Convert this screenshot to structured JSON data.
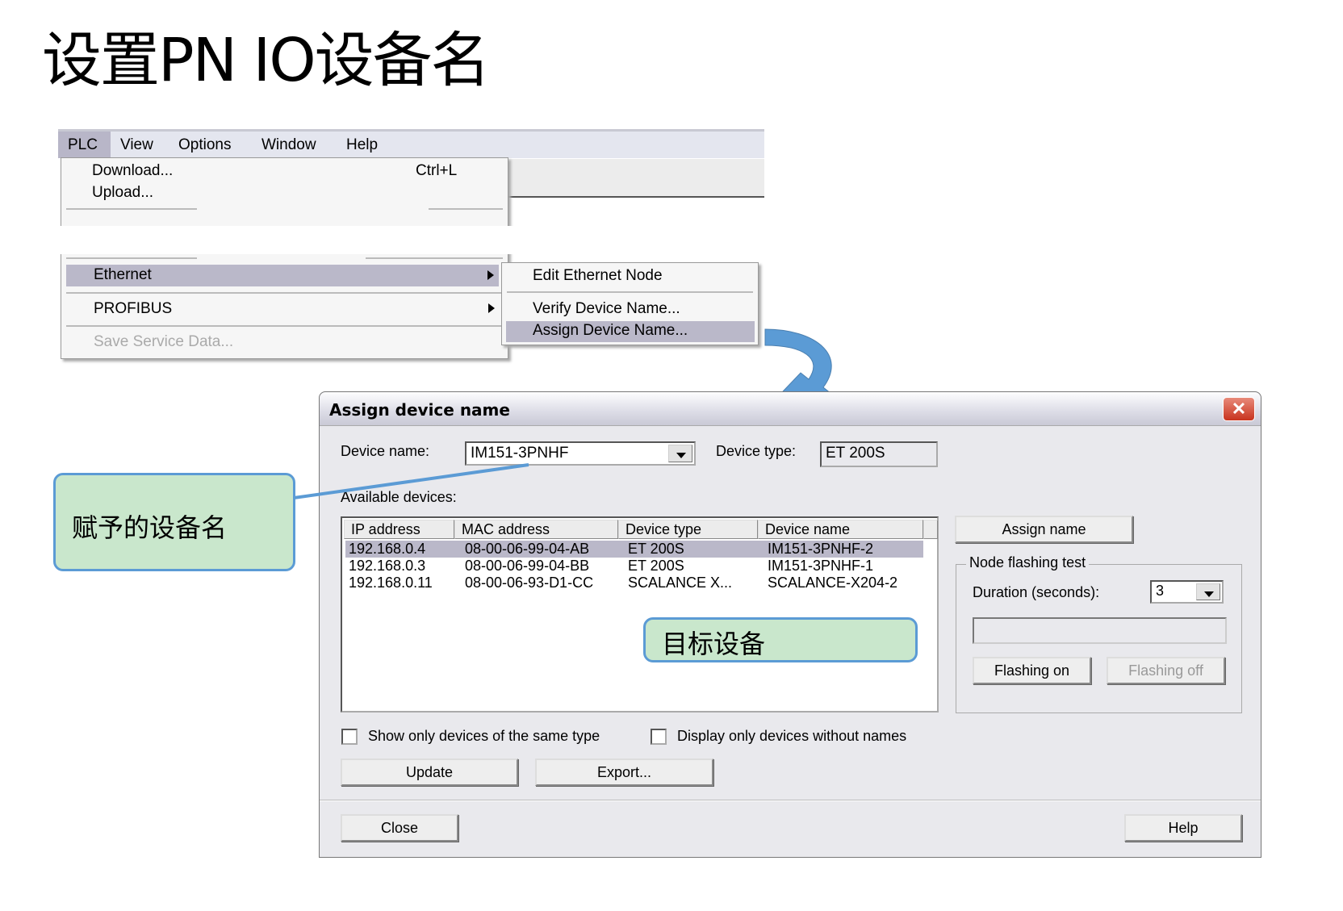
{
  "title": "设置PN IO设备名",
  "menubar": [
    "PLC",
    "View",
    "Options",
    "Window",
    "Help"
  ],
  "plc_menu": {
    "download": "Download...",
    "download_shortcut": "Ctrl+L",
    "upload": "Upload...",
    "ethernet": "Ethernet",
    "profibus": "PROFIBUS",
    "save_service": "Save Service Data..."
  },
  "ethernet_submenu": {
    "edit": "Edit Ethernet Node",
    "verify": "Verify Device Name...",
    "assign": "Assign Device Name..."
  },
  "dialog": {
    "title": "Assign device name",
    "device_name_label": "Device name:",
    "device_name_value": "IM151-3PNHF",
    "device_type_label": "Device type:",
    "device_type_value": "ET 200S",
    "available_label": "Available devices:",
    "columns": [
      "IP address",
      "MAC address",
      "Device type",
      "Device name"
    ],
    "rows": [
      [
        "192.168.0.4",
        "08-00-06-99-04-AB",
        "ET 200S",
        "IM151-3PNHF-2"
      ],
      [
        "192.168.0.3",
        "08-00-06-99-04-BB",
        "ET 200S",
        "IM151-3PNHF-1"
      ],
      [
        "192.168.0.11",
        "08-00-06-93-D1-CC",
        "SCALANCE X...",
        "SCALANCE-X204-2"
      ]
    ],
    "assign_name": "Assign name",
    "node_flashing": "Node flashing test",
    "duration_label": "Duration (seconds):",
    "duration_value": "3",
    "flashing_on": "Flashing on",
    "flashing_off": "Flashing off",
    "cb_same_type": "Show only devices of the same type",
    "cb_without_names": "Display only devices without names",
    "update": "Update",
    "export": "Export...",
    "close": "Close",
    "help": "Help"
  },
  "callouts": {
    "assigned_name": "赋予的设备名",
    "target_device": "目标设备"
  },
  "colors": {
    "accent": "#5b9bd5",
    "callout_bg": "#c9e7cc",
    "highlight": "#bab8c9"
  }
}
